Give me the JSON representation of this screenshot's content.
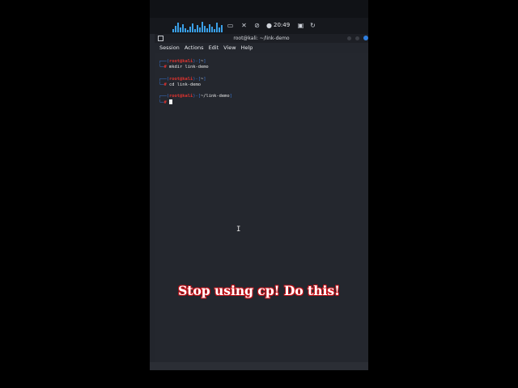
{
  "taskbar": {
    "clock": "20:49",
    "icons": [
      "audio-visualizer-icon",
      "window-icon",
      "speaker-muted-icon",
      "microphone-muted-icon",
      "bluetooth-icon",
      "lock-icon",
      "refresh-icon"
    ]
  },
  "window": {
    "title": "root@kali: ~/link-demo",
    "menu": [
      "Session",
      "Actions",
      "Edit",
      "View",
      "Help"
    ]
  },
  "terminal": {
    "blocks": [
      {
        "user": "root@kali",
        "dir": "~",
        "command": "mkdir link-demo"
      },
      {
        "user": "root@kali",
        "dir": "~",
        "command": "cd link-demo"
      },
      {
        "user": "root@kali",
        "dir": "~/link-demo",
        "command": ""
      }
    ],
    "prompt_symbol": "#"
  },
  "overlay": {
    "caption": "Stop using cp! Do this!"
  },
  "colors": {
    "terminal_bg": "#24272e",
    "prompt_blue": "#3b78d8",
    "prompt_red": "#e0332f",
    "caption_outline": "#c4131a"
  }
}
